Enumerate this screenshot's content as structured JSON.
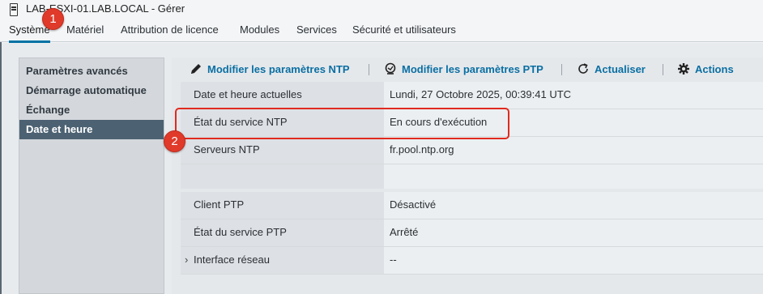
{
  "window": {
    "title": "LAB-ESXI-01.LAB.LOCAL - Gérer",
    "host_icon": "server-icon"
  },
  "tabs": [
    {
      "label": "Système",
      "active": true
    },
    {
      "label": "Matériel",
      "active": false
    },
    {
      "label": "Attribution de licence",
      "active": false
    },
    {
      "label": "Modules",
      "active": false
    },
    {
      "label": "Services",
      "active": false
    },
    {
      "label": "Sécurité et utilisateurs",
      "active": false
    }
  ],
  "annotations": {
    "badge1": "1",
    "badge2": "2",
    "highlight_color": "#e02a1f"
  },
  "sidebar": {
    "items": [
      {
        "label": "Paramètres avancés",
        "active": false
      },
      {
        "label": "Démarrage automatique",
        "active": false
      },
      {
        "label": "Échange",
        "active": false
      },
      {
        "label": "Date et heure",
        "active": true
      }
    ]
  },
  "toolbar": {
    "ntp_label": "Modifier les paramètres NTP",
    "ntp_icon": "pencil-icon",
    "ptp_label": "Modifier les paramètres PTP",
    "ptp_icon": "ptp-icon",
    "refresh_label": "Actualiser",
    "refresh_icon": "refresh-icon",
    "actions_label": "Actions",
    "actions_icon": "gear-icon"
  },
  "rows": [
    {
      "label": "Date et heure actuelles",
      "value": "Lundi, 27 Octobre 2025, 00:39:41 UTC"
    },
    {
      "label": "État du service NTP",
      "value": "En cours d'exécution"
    },
    {
      "label": "Serveurs NTP",
      "value": "fr.pool.ntp.org"
    },
    {
      "label": "Client PTP",
      "value": "Désactivé"
    },
    {
      "label": "État du service PTP",
      "value": "Arrêté"
    },
    {
      "label": "Interface réseau",
      "value": "--"
    }
  ],
  "colors": {
    "accent": "#0072a3",
    "link": "#0a6fa3",
    "nav_active": "#4c6273",
    "badge": "#e03a2a"
  }
}
